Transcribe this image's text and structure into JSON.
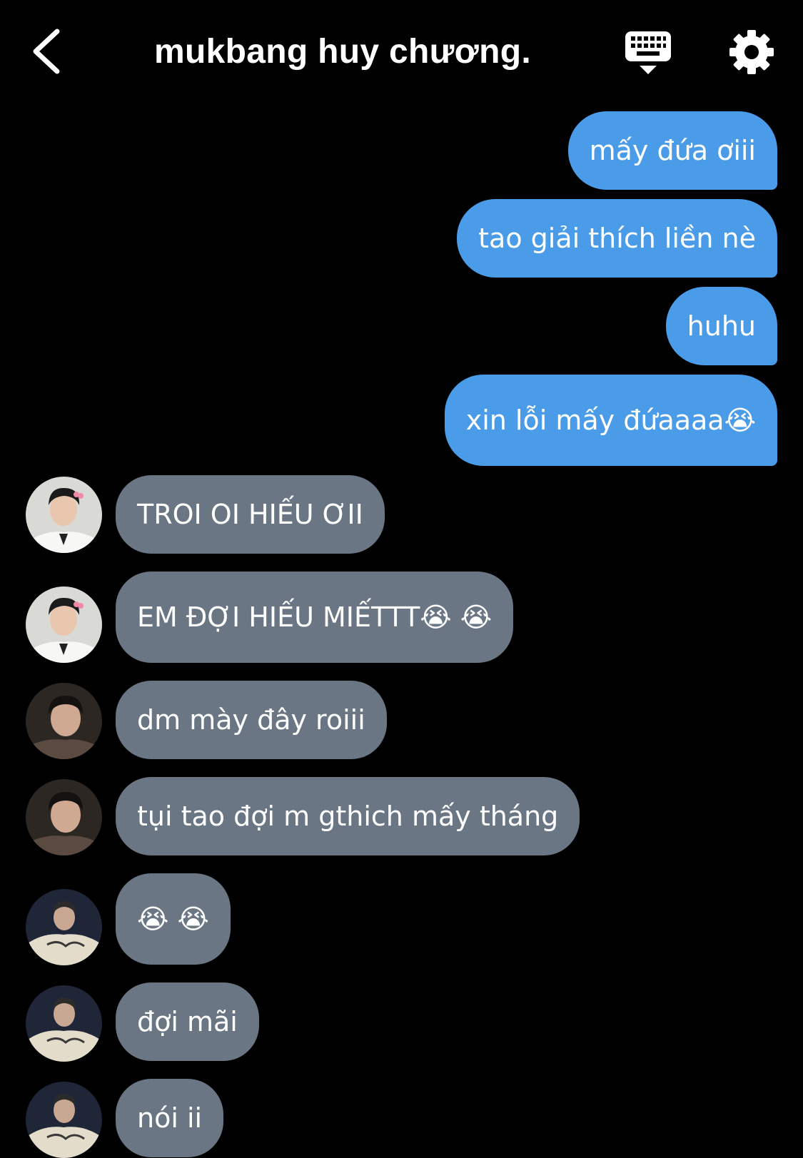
{
  "header": {
    "back_icon": "chevron-left-icon",
    "title": "mukbang huy chương.",
    "keyboard_icon": "keyboard-icon",
    "settings_icon": "gear-icon"
  },
  "colors": {
    "background": "#000000",
    "sent_bubble": "#4a9be8",
    "received_bubble": "#6a7683",
    "text": "#ffffff"
  },
  "messages": [
    {
      "direction": "sent",
      "text": "mấy đứa ơiii"
    },
    {
      "direction": "sent",
      "text": "tao giải thích liền nè"
    },
    {
      "direction": "sent",
      "text": "huhu"
    },
    {
      "direction": "sent",
      "text": "xin lỗi mấy đứaaaa😭"
    },
    {
      "direction": "received",
      "sender_avatar": "avatar-1",
      "text": "TROI OI HIẾU ƠII"
    },
    {
      "direction": "received",
      "sender_avatar": "avatar-1",
      "text": "EM ĐỢI HIẾU MIẾTTT😭 😭"
    },
    {
      "direction": "received",
      "sender_avatar": "avatar-2",
      "text": "dm mày đây roiii"
    },
    {
      "direction": "received",
      "sender_avatar": "avatar-2",
      "text": "tụi tao đợi m gthich mấy tháng"
    },
    {
      "direction": "received",
      "sender_avatar": "avatar-3",
      "text": "😭 😭"
    },
    {
      "direction": "received",
      "sender_avatar": "avatar-3",
      "text": "đợi mãi"
    },
    {
      "direction": "received",
      "sender_avatar": "avatar-3",
      "text": "nói ii"
    }
  ]
}
